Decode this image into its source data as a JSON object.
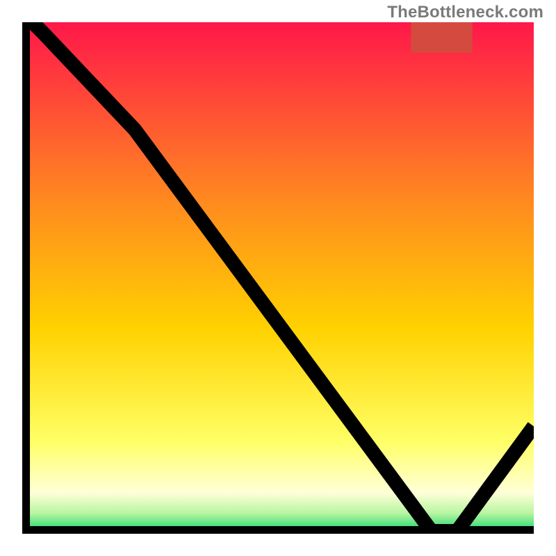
{
  "watermark": "TheBottleneck.com",
  "gradient_stops": [
    {
      "offset": "0%",
      "color": "#ff174a"
    },
    {
      "offset": "35%",
      "color": "#ff8a1f"
    },
    {
      "offset": "60%",
      "color": "#ffd200"
    },
    {
      "offset": "82%",
      "color": "#ffff66"
    },
    {
      "offset": "92%",
      "color": "#ffffd8"
    },
    {
      "offset": "96%",
      "color": "#b8f5a0"
    },
    {
      "offset": "100%",
      "color": "#00d46a"
    }
  ],
  "chart_data": {
    "type": "line",
    "title": "",
    "xlabel": "",
    "ylabel": "",
    "xlim": [
      0,
      100
    ],
    "ylim": [
      0,
      100
    ],
    "x": [
      0,
      4,
      22,
      80,
      85,
      100
    ],
    "values": [
      102,
      98,
      79,
      0.5,
      0.5,
      21
    ],
    "optimum_range_x": [
      76,
      88
    ],
    "optimum_y": 99,
    "optimum_marker_color": "#d44a3f"
  }
}
